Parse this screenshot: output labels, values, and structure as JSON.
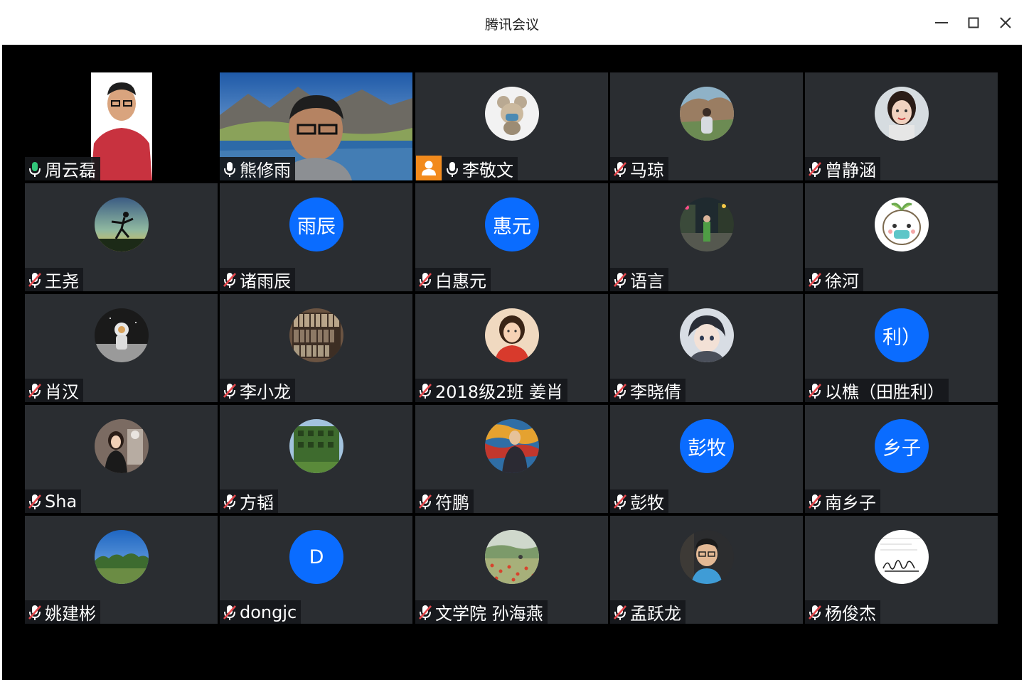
{
  "window": {
    "title": "腾讯会议"
  },
  "participants": [
    {
      "name": "周云磊",
      "kind": "video",
      "mic": "on",
      "active": true
    },
    {
      "name": "熊修雨",
      "kind": "video",
      "mic": "on-white"
    },
    {
      "name": "李敬文",
      "kind": "photo",
      "mic": "on-white",
      "host": true,
      "photo": "koala-mask"
    },
    {
      "name": "马琼",
      "kind": "photo",
      "mic": "muted",
      "photo": "cliff-person"
    },
    {
      "name": "曾静涵",
      "kind": "photo",
      "mic": "muted",
      "photo": "girl-portrait"
    },
    {
      "name": "王尧",
      "kind": "photo",
      "mic": "muted",
      "photo": "ballet-silhouette"
    },
    {
      "name": "诸雨辰",
      "kind": "text",
      "initials": "雨辰",
      "mic": "muted"
    },
    {
      "name": "白惠元",
      "kind": "text",
      "initials": "惠元",
      "mic": "muted"
    },
    {
      "name": "语言",
      "kind": "photo",
      "mic": "muted",
      "photo": "night-street"
    },
    {
      "name": "徐河",
      "kind": "photo",
      "mic": "muted",
      "photo": "cartoon-mask"
    },
    {
      "name": "肖汉",
      "kind": "photo",
      "mic": "muted",
      "photo": "astronaut-moon"
    },
    {
      "name": "李小龙",
      "kind": "photo",
      "mic": "muted",
      "photo": "bookshelf"
    },
    {
      "name": "2018级2班 姜肖",
      "kind": "photo",
      "mic": "muted",
      "photo": "woman-red-shirt"
    },
    {
      "name": "李晓倩",
      "kind": "photo",
      "mic": "muted",
      "photo": "anime-boy"
    },
    {
      "name": "以樵（田胜利）",
      "kind": "text",
      "initials": "利）",
      "mic": "muted"
    },
    {
      "name": "Sha",
      "kind": "photo",
      "mic": "muted",
      "photo": "woman-museum"
    },
    {
      "name": "方韬",
      "kind": "photo",
      "mic": "muted",
      "photo": "ivy-building"
    },
    {
      "name": "符鹏",
      "kind": "photo",
      "mic": "muted",
      "photo": "painting-portrait"
    },
    {
      "name": "彭牧",
      "kind": "text",
      "initials": "彭牧",
      "mic": "muted"
    },
    {
      "name": "南乡子",
      "kind": "text",
      "initials": "乡子",
      "mic": "muted"
    },
    {
      "name": "姚建彬",
      "kind": "photo",
      "mic": "muted",
      "photo": "field-sky"
    },
    {
      "name": "dongjc",
      "kind": "text",
      "initials": "D",
      "mic": "muted"
    },
    {
      "name": "文学院 孙海燕",
      "kind": "photo",
      "mic": "muted",
      "photo": "poppy-field"
    },
    {
      "name": "孟跃龙",
      "kind": "photo",
      "mic": "muted",
      "photo": "man-glasses"
    },
    {
      "name": "杨俊杰",
      "kind": "photo",
      "mic": "muted",
      "photo": "signature-doc"
    }
  ],
  "colors": {
    "accent": "#0a6cff",
    "tile": "#2a2d31",
    "active_border": "#31c67a",
    "host_badge": "#f28a1c",
    "mic_active": "#31c67a",
    "mic_muted": "#e5484d"
  }
}
